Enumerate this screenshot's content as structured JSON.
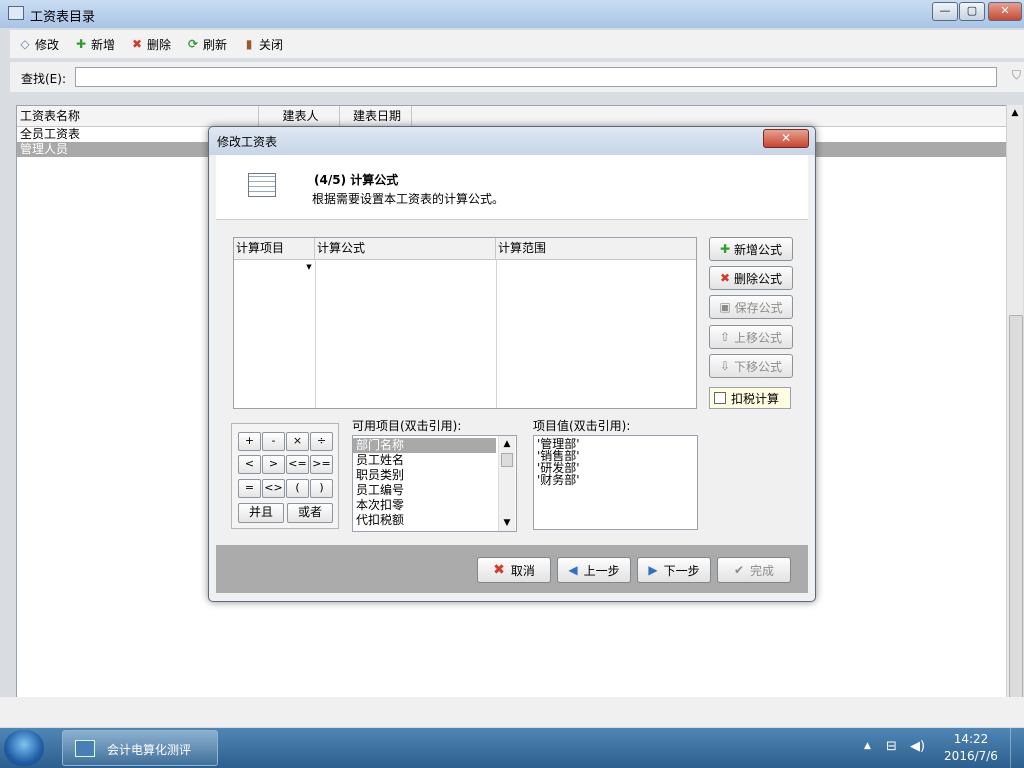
{
  "window": {
    "title": "工资表目录",
    "min": "—",
    "max": "▢",
    "close": "✕"
  },
  "toolbar": {
    "edit": "修改",
    "add": "新增",
    "delete": "删除",
    "refresh": "刷新",
    "close": "关闭"
  },
  "search": {
    "label": "查找(E):",
    "value": "",
    "placeholder": ""
  },
  "list": {
    "headers": [
      "工资表名称",
      "建表人",
      "建表日期"
    ],
    "rows": [
      {
        "name": "全员工资表"
      },
      {
        "name": "管理人员"
      }
    ]
  },
  "dialog": {
    "title": "修改工资表",
    "close": "✕",
    "step": "(4/5) 计算公式",
    "description": "根据需要设置本工资表的计算公式。",
    "grid_headers": [
      "计算项目",
      "计算公式",
      "计算范围"
    ],
    "side_buttons": {
      "add": "新增公式",
      "delete": "删除公式",
      "save": "保存公式",
      "up": "上移公式",
      "down": "下移公式"
    },
    "tax_checkbox": "扣税计算",
    "operators": [
      "+",
      "-",
      "×",
      "÷",
      "<",
      ">",
      "<=",
      ">=",
      "=",
      "<>",
      "(",
      ")"
    ],
    "op_and": "并且",
    "op_or": "或者",
    "available_label": "可用项目(双击引用):",
    "available_items": [
      "部门名称",
      "员工姓名",
      "职员类别",
      "员工编号",
      "本次扣零",
      "代扣税额"
    ],
    "values_label": "项目值(双击引用):",
    "values": [
      "'管理部'",
      "'销售部'",
      "'研发部'",
      "'财务部'"
    ],
    "footer": {
      "cancel": "取消",
      "prev": "上一步",
      "next": "下一步",
      "finish": "完成"
    }
  },
  "taskbar": {
    "app": "会计电算化测评",
    "time": "14:22",
    "date": "2016/7/6"
  },
  "colors": {
    "selection": "#a9a9a9",
    "add_green": "#2f9e2f",
    "delete_red": "#d23a2a",
    "nav_blue": "#2e6fc7"
  }
}
